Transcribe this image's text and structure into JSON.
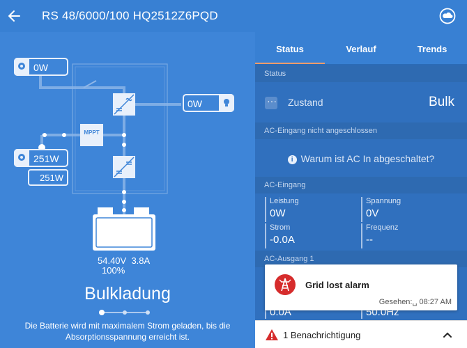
{
  "header": {
    "title": "RS 48/6000/100 HQ2512Z6PQD"
  },
  "diagram": {
    "pv_top_power": "0W",
    "ac_out_power": "0W",
    "pv_main_power": "251W",
    "pv_sub_power": "251W",
    "mppt_label": "MPPT",
    "battery_voltage": "54.40V",
    "battery_current": "3.8A",
    "battery_soc": "100%"
  },
  "state": {
    "title": "Bulkladung",
    "description": "Die Batterie wird mit maximalem Strom geladen, bis die Absorptionsspannung erreicht ist.",
    "pager_active": 0,
    "pager_count": 3
  },
  "tabs": [
    {
      "label": "Status"
    },
    {
      "label": "Verlauf"
    },
    {
      "label": "Trends"
    }
  ],
  "status_panel": {
    "status_header": "Status",
    "zustand_label": "Zustand",
    "zustand_value": "Bulk",
    "ac_not_connected_header": "AC-Eingang nicht angeschlossen",
    "ac_info_text": "Warum ist AC In abgeschaltet?",
    "ac_input_header": "AC-Eingang",
    "ac_input": {
      "leistung_label": "Leistung",
      "leistung_value": "0W",
      "spannung_label": "Spannung",
      "spannung_value": "0V",
      "strom_label": "Strom",
      "strom_value": "-0.0A",
      "frequenz_label": "Frequenz",
      "frequenz_value": "--"
    },
    "ac_output_header": "AC-Ausgang 1",
    "ac_output_partial": {
      "left_value": "0.0A",
      "right_value": "50.0Hz"
    }
  },
  "alarm": {
    "title": "Grid lost alarm",
    "seen": "Gesehen:␣ 08:27 AM"
  },
  "notification": {
    "text": "1 Benachrichtigung"
  },
  "colors": {
    "background": "#3d83d6",
    "header": "#3880d3",
    "panel": "#2c6bb6",
    "tab_indicator": "#f39c6b",
    "alarm_red": "#d62c2c"
  }
}
